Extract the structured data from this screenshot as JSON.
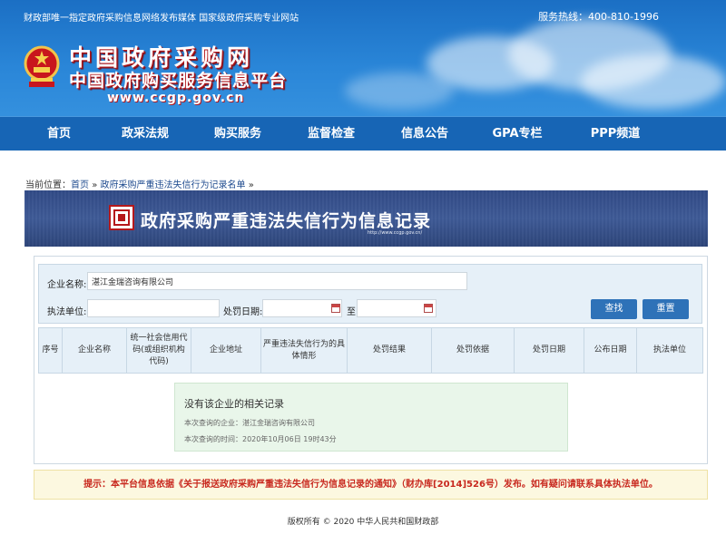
{
  "header": {
    "tagline": "财政部唯一指定政府采购信息网络发布媒体 国家级政府采购专业网站",
    "hotline": "服务热线：400-810-1996",
    "logo_line1": "中国政府采购网",
    "logo_line2": "中国政府购买服务信息平台",
    "logo_url": "www.ccgp.gov.cn"
  },
  "nav": {
    "items": [
      {
        "label": "首页"
      },
      {
        "label": "政采法规"
      },
      {
        "label": "购买服务"
      },
      {
        "label": "监督检查"
      },
      {
        "label": "信息公告"
      },
      {
        "label": "GPA专栏"
      },
      {
        "label": "PPP频道"
      }
    ]
  },
  "breadcrumb": {
    "prefix": "当前位置：",
    "home": "首页",
    "sep": "»",
    "current": "政府采购严重违法失信行为记录名单",
    "trail": "»"
  },
  "banner": {
    "title": "政府采购严重违法失信行为信息记录",
    "url": "http://www.ccgp.gov.cn/"
  },
  "search": {
    "company_label": "企业名称:",
    "company_value": "湛江金瑞咨询有限公司",
    "unit_label": "执法单位:",
    "unit_value": "",
    "date_label": "处罚日期:",
    "date_from": "",
    "to_label": "至",
    "date_to": "",
    "search_button": "查找",
    "reset_button": "重置"
  },
  "table": {
    "headers": [
      "序号",
      "企业名称",
      "统一社会信用代码(或组织机构代码)",
      "企业地址",
      "严重违法失信行为的具体情形",
      "处罚结果",
      "处罚依据",
      "处罚日期",
      "公布日期",
      "执法单位"
    ]
  },
  "empty": {
    "title": "没有该企业的相关记录",
    "line1": "本次查询的企业：湛江金瑞咨询有限公司",
    "line2": "本次查询的时间：2020年10月06日 19时43分"
  },
  "notice": "提示：本平台信息依据《关于报送政府采购严重违法失信行为信息记录的通知》（财办库[2014]526号）发布。如有疑问请联系具体执法单位。",
  "footer": "版权所有 © 2020 中华人民共和国财政部",
  "colors": {
    "header_blue": "#2a86d8",
    "nav_blue": "#1765b5",
    "banner_navy": "#3e5a96",
    "button_blue": "#2e72b8",
    "notice_red": "#c8281e"
  }
}
